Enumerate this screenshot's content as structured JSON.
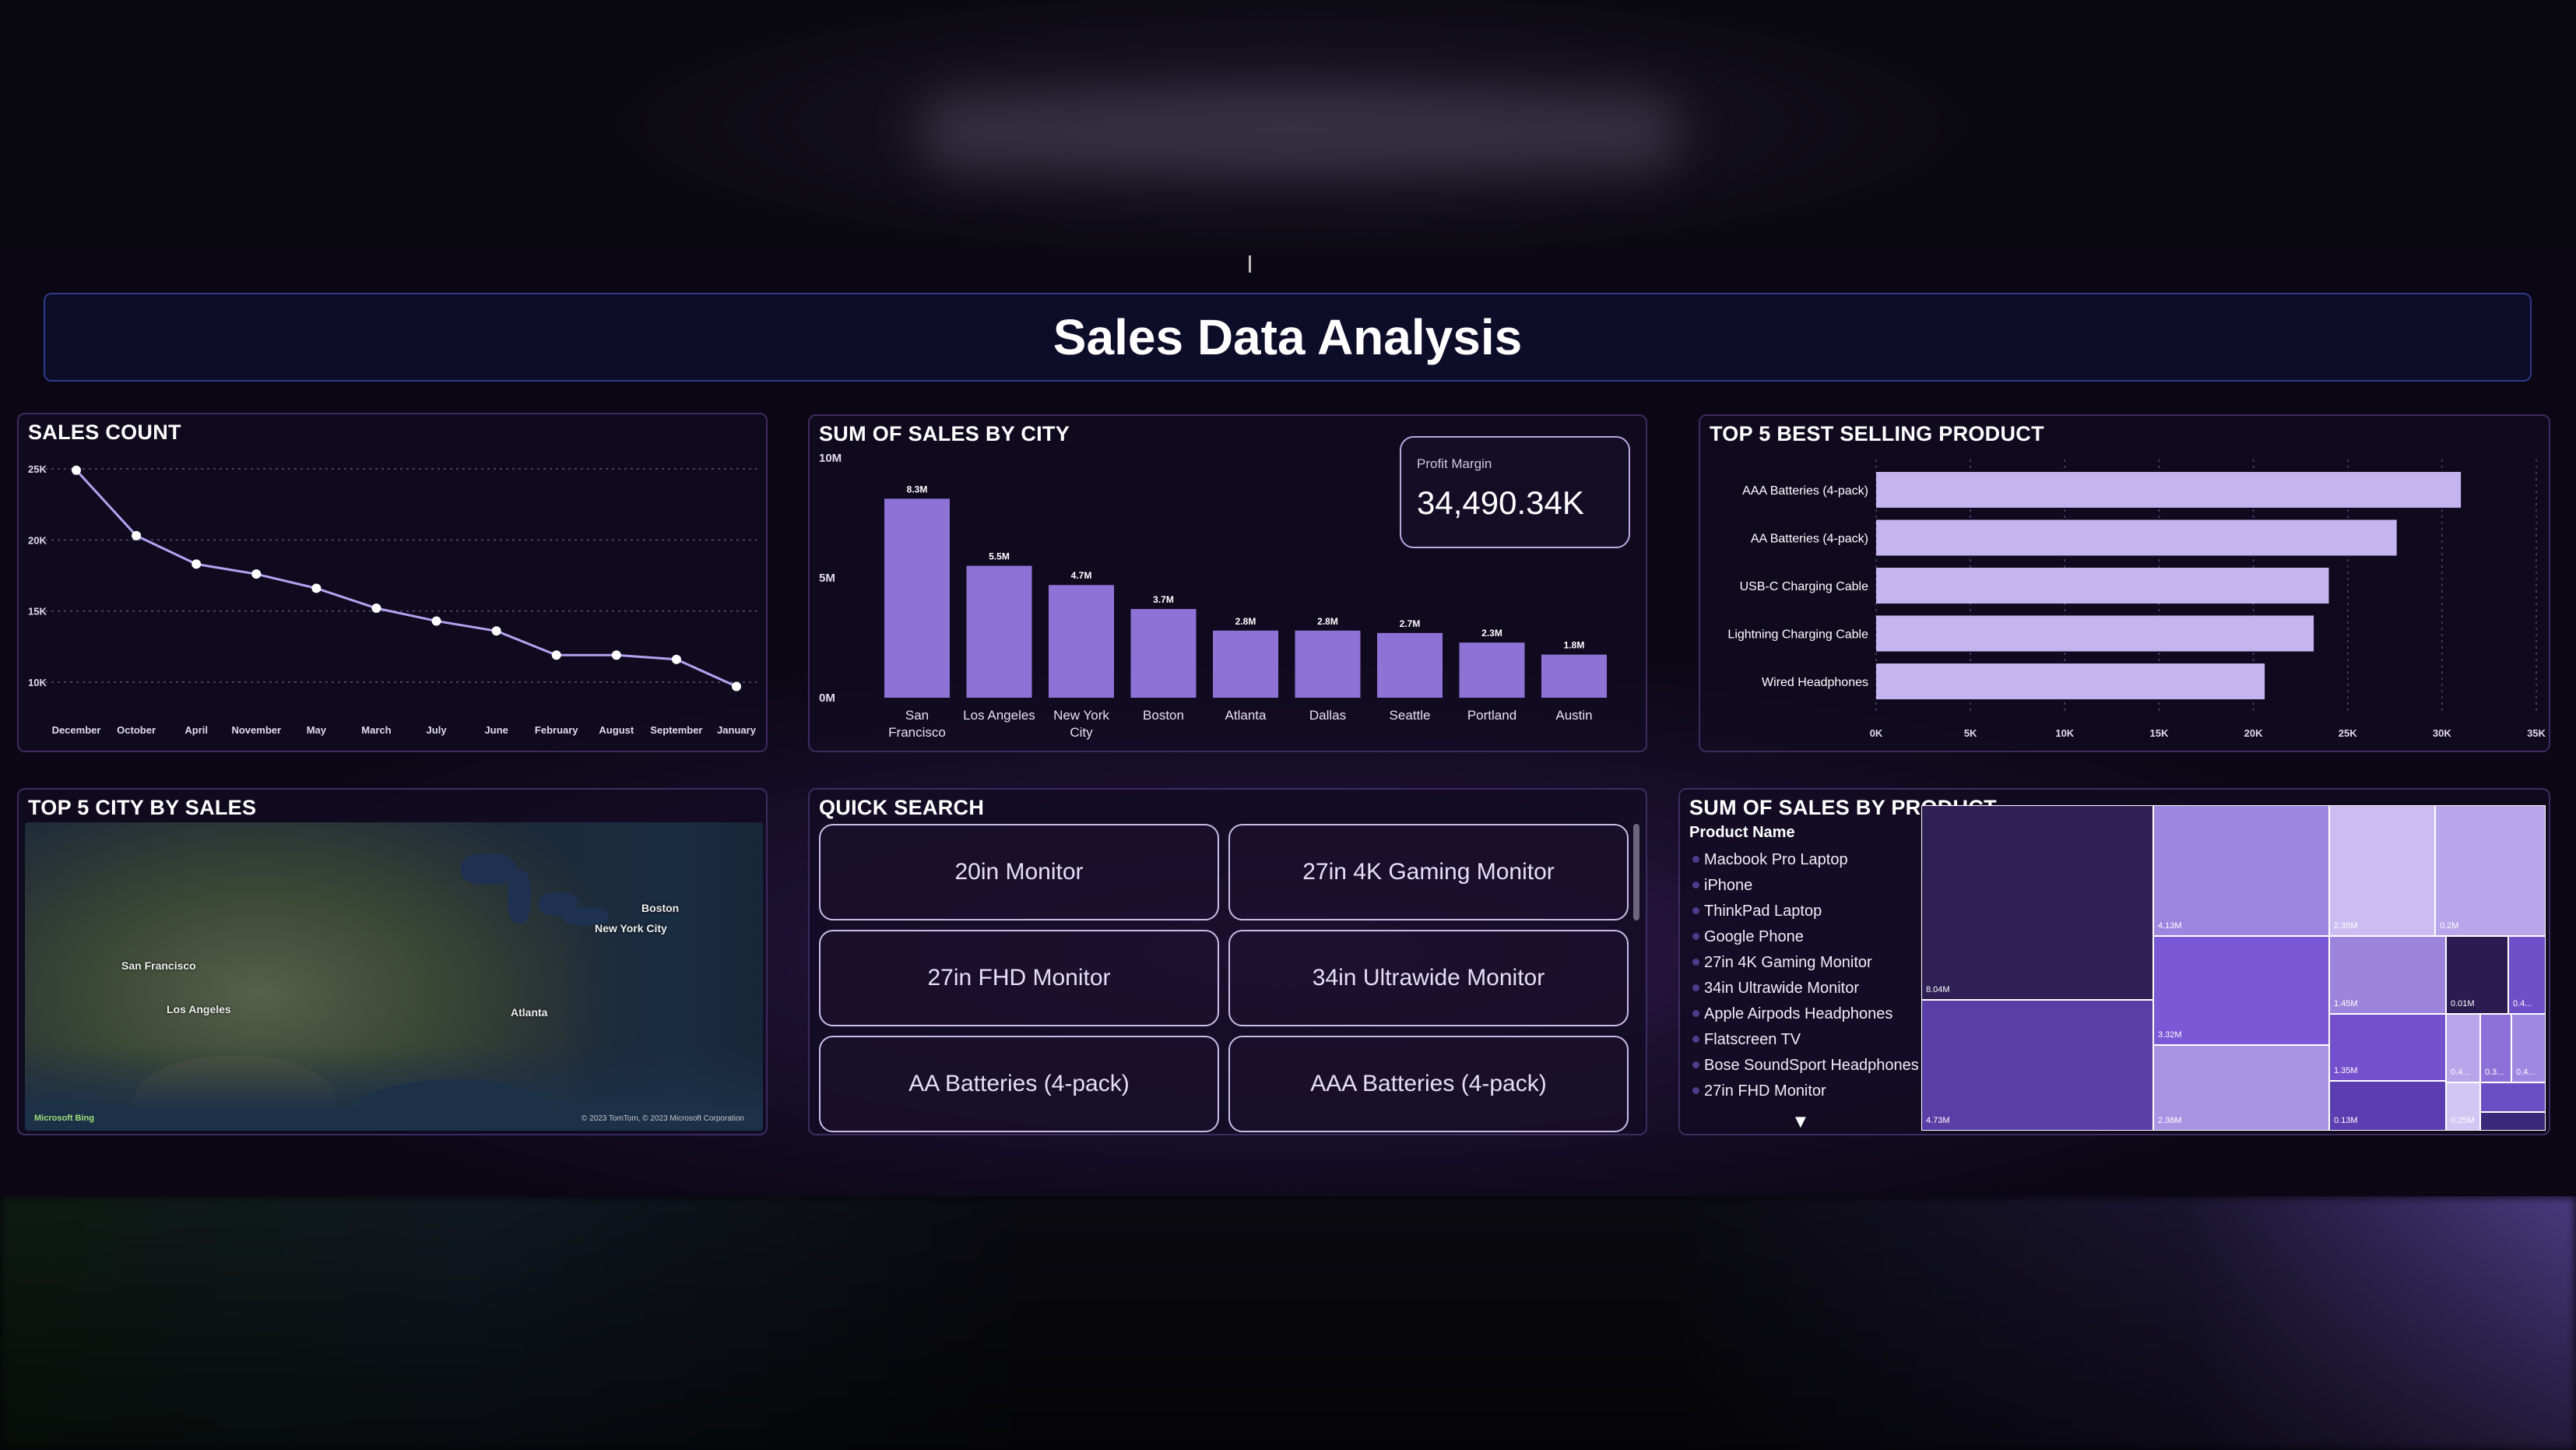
{
  "dashboard": {
    "title": "Sales Data Analysis"
  },
  "colors": {
    "bar": "#8e72d6",
    "bar_light": "#c4b5f0",
    "line": "#b3a3f0",
    "panel_border": "#3b2c60",
    "background": "#0b0714"
  },
  "sales_count": {
    "title": "SALES COUNT"
  },
  "city_sales": {
    "title": "SUM OF SALES BY CITY",
    "kpi_label": "Profit Margin",
    "kpi_value": "34,490.34K"
  },
  "top5_product": {
    "title": "TOP 5 BEST SELLING PRODUCT"
  },
  "map": {
    "title": "TOP 5 CITY BY SALES",
    "cities": [
      "San Francisco",
      "Los Angeles",
      "Boston",
      "New York City",
      "Atlanta"
    ],
    "logo": "Microsoft Bing",
    "copyright": "© 2023 TomTom, © 2023 Microsoft Corporation"
  },
  "quick_search": {
    "title": "QUICK SEARCH",
    "buttons": [
      "20in Monitor",
      "27in 4K Gaming Monitor",
      "27in FHD Monitor",
      "34in Ultrawide Monitor",
      "AA Batteries (4-pack)",
      "AAA Batteries (4-pack)"
    ]
  },
  "treemap": {
    "title": "SUM OF SALES BY PRODUCT",
    "list_header": "Product Name",
    "products": [
      "Macbook Pro Laptop",
      "iPhone",
      "ThinkPad Laptop",
      "Google Phone",
      "27in 4K Gaming Monitor",
      "34in Ultrawide Monitor",
      "Apple Airpods Headphones",
      "Flatscreen TV",
      "Bose SoundSport Headphones",
      "27in FHD Monitor"
    ],
    "tile_labels": [
      "8.04M",
      "4.73M",
      "4.13M",
      "3.32M",
      "2.36M",
      "2.35M",
      "1.45M",
      "1.35M",
      "0.13M",
      "0.01M",
      "0.2M",
      "0.4...",
      "0.4...",
      "0.3...",
      "0.4...",
      "0.25M"
    ]
  },
  "chart_data": [
    {
      "type": "line",
      "title": "SALES COUNT",
      "x": [
        "December",
        "October",
        "April",
        "November",
        "May",
        "March",
        "July",
        "June",
        "February",
        "August",
        "September",
        "January"
      ],
      "values": [
        24900,
        20300,
        18300,
        17600,
        16600,
        15200,
        14300,
        13600,
        11900,
        11900,
        11600,
        9700
      ],
      "y_ticks": [
        "25K",
        "20K",
        "15K",
        "10K"
      ],
      "ylim": [
        10000,
        25000
      ],
      "grid": true
    },
    {
      "type": "bar",
      "title": "SUM OF SALES BY CITY",
      "categories": [
        "San Francisco",
        "Los Angeles",
        "New York City",
        "Boston",
        "Atlanta",
        "Dallas",
        "Seattle",
        "Portland",
        "Austin"
      ],
      "category_lines": [
        [
          "San",
          "Francisco"
        ],
        [
          "Los Angeles"
        ],
        [
          "New York",
          "City"
        ],
        [
          "Boston"
        ],
        [
          "Atlanta"
        ],
        [
          "Dallas"
        ],
        [
          "Seattle"
        ],
        [
          "Portland"
        ],
        [
          "Austin"
        ]
      ],
      "values": [
        8.3,
        5.5,
        4.7,
        3.7,
        2.8,
        2.8,
        2.7,
        2.3,
        1.8
      ],
      "value_labels": [
        "8.3M",
        "5.5M",
        "4.7M",
        "3.7M",
        "2.8M",
        "2.8M",
        "2.7M",
        "2.3M",
        "1.8M"
      ],
      "y_ticks": [
        "10M",
        "5M",
        "0M"
      ],
      "ylim": [
        0,
        10
      ]
    },
    {
      "type": "bar",
      "orientation": "horizontal",
      "title": "TOP 5 BEST SELLING PRODUCT",
      "categories": [
        "AAA Batteries (4-pack)",
        "AA Batteries (4-pack)",
        "USB-C Charging Cable",
        "Lightning Charging Cable",
        "Wired Headphones"
      ],
      "values": [
        31000,
        27600,
        24000,
        23200,
        20600
      ],
      "x_ticks": [
        "0K",
        "5K",
        "10K",
        "15K",
        "20K",
        "25K",
        "30K",
        "35K"
      ],
      "xlim": [
        0,
        35000
      ]
    }
  ]
}
